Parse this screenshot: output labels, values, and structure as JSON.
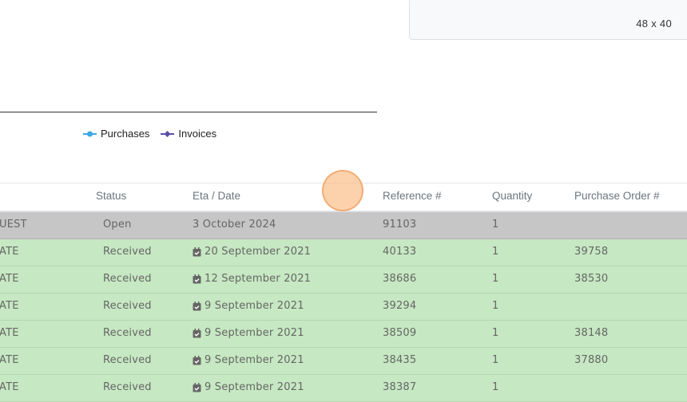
{
  "dimension_panel": {
    "text": "48 x 40"
  },
  "legend": [
    {
      "label": "Purchases",
      "color": "#3ba7e6"
    },
    {
      "label": "Invoices",
      "color": "#5a4fa8"
    }
  ],
  "table": {
    "headers": {
      "status": "Status",
      "eta_date": "Eta / Date",
      "reference": "Reference #",
      "quantity": "Quantity",
      "purchase_order": "Purchase Order #"
    },
    "rows": [
      {
        "type": "UEST",
        "status": "Open",
        "date": "3 October 2024",
        "reference": "91103",
        "quantity": "1",
        "po": "",
        "state": "open",
        "calendar": false
      },
      {
        "type": "ATE",
        "status": "Received",
        "date": "20 September 2021",
        "reference": "40133",
        "quantity": "1",
        "po": "39758",
        "state": "received",
        "calendar": true
      },
      {
        "type": "ATE",
        "status": "Received",
        "date": "12 September 2021",
        "reference": "38686",
        "quantity": "1",
        "po": "38530",
        "state": "received",
        "calendar": true
      },
      {
        "type": "ATE",
        "status": "Received",
        "date": "9 September 2021",
        "reference": "39294",
        "quantity": "1",
        "po": "",
        "state": "received",
        "calendar": true
      },
      {
        "type": "ATE",
        "status": "Received",
        "date": "9 September 2021",
        "reference": "38509",
        "quantity": "1",
        "po": "38148",
        "state": "received",
        "calendar": true
      },
      {
        "type": "ATE",
        "status": "Received",
        "date": "9 September 2021",
        "reference": "38435",
        "quantity": "1",
        "po": "37880",
        "state": "received",
        "calendar": true
      },
      {
        "type": "ATE",
        "status": "Received",
        "date": "9 September 2021",
        "reference": "38387",
        "quantity": "1",
        "po": "",
        "state": "received",
        "calendar": true
      }
    ]
  },
  "colors": {
    "open_row": "#c6c6c6",
    "received_row": "#c6e8c2",
    "cursor": "#f8b678"
  }
}
